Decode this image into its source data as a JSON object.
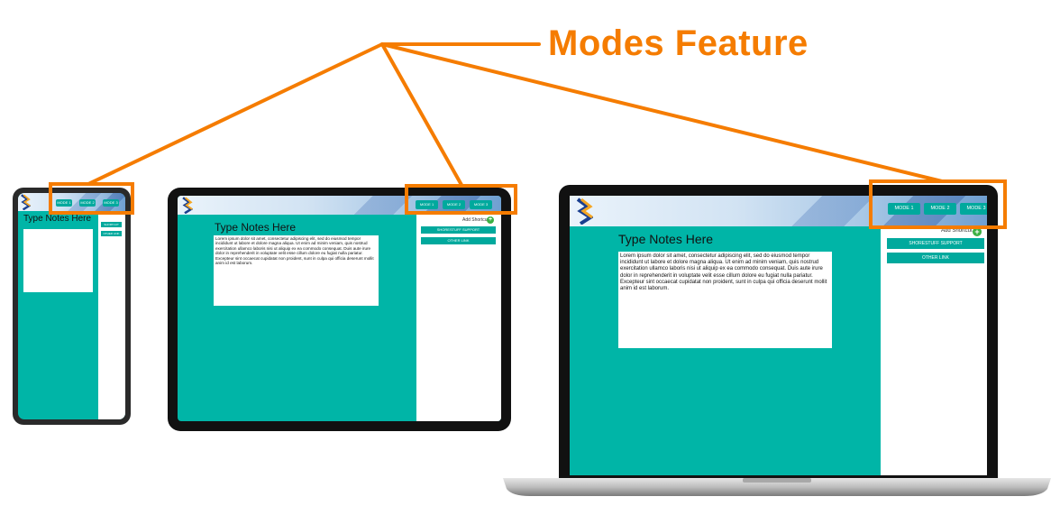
{
  "callout": {
    "label": "Modes Feature"
  },
  "modes": [
    "MODE 1",
    "MODE 2",
    "MODE 3"
  ],
  "notes": {
    "title": "Type Notes Here",
    "body": "Lorem ipsum dolor sit amet, consectetur adipiscing elit, sed do eiusmod tempor incididunt ut labore et dolore magna aliqua. Ut enim ad minim veniam, quis nostrud exercitation ullamco laboris nisi ut aliquip ex ea commodo consequat. Duis aute irure dolor in reprehenderit in voluptate velit esse cillum dolore eu fugiat nulla pariatur. Excepteur sint occaecat cupidatat non proident, sunt in culpa qui officia deserunt mollit anim id est laborum."
  },
  "sidebar": {
    "add_shortcut": "Add Shortcut",
    "plus": "+",
    "links": [
      "SHORESTUFF SUPPORT",
      "OTHER LINK"
    ],
    "phone_links": [
      "SHORTCUT",
      "OTHER LINK"
    ]
  },
  "colors": {
    "accent": "#00b5a7",
    "button": "#00a99d",
    "highlight": "#f57c00",
    "plus": "#3cb043"
  },
  "icons": [
    "logo-icon",
    "plus-icon"
  ]
}
